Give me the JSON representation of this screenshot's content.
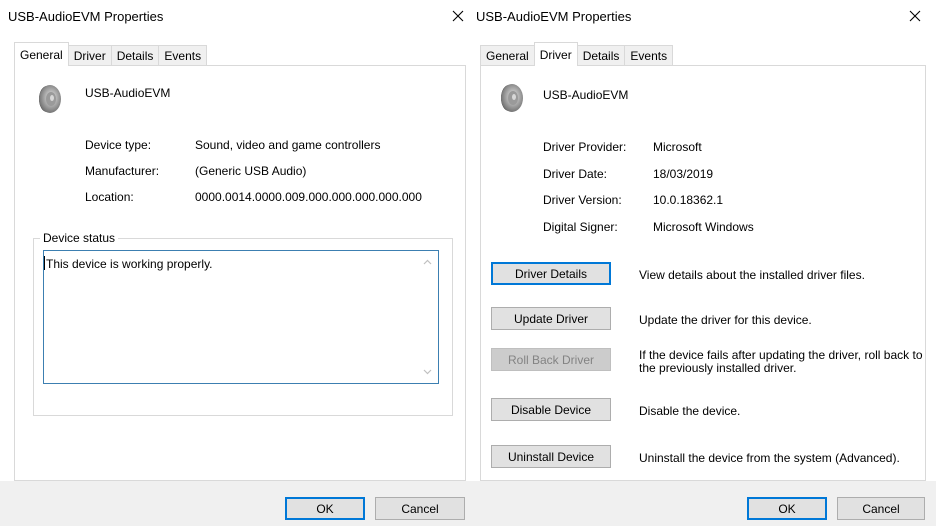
{
  "left": {
    "title": "USB-AudioEVM Properties",
    "tabs": [
      "General",
      "Driver",
      "Details",
      "Events"
    ],
    "device_name": "USB-AudioEVM",
    "fields": [
      {
        "label": "Device type:",
        "value": "Sound, video and game controllers"
      },
      {
        "label": "Manufacturer:",
        "value": "(Generic USB Audio)"
      },
      {
        "label": "Location:",
        "value": "0000.0014.0000.009.000.000.000.000.000"
      }
    ],
    "status_label": "Device status",
    "status_text": "This device is working properly.",
    "ok_label": "OK",
    "cancel_label": "Cancel"
  },
  "right": {
    "title": "USB-AudioEVM Properties",
    "tabs": [
      "General",
      "Driver",
      "Details",
      "Events"
    ],
    "device_name": "USB-AudioEVM",
    "fields": [
      {
        "label": "Driver Provider:",
        "value": "Microsoft"
      },
      {
        "label": "Driver Date:",
        "value": "18/03/2019"
      },
      {
        "label": "Driver Version:",
        "value": "10.0.18362.1"
      },
      {
        "label": "Digital Signer:",
        "value": "Microsoft Windows"
      }
    ],
    "actions": [
      {
        "label": "Driver Details",
        "desc": "View details about the installed driver files."
      },
      {
        "label": "Update Driver",
        "desc": "Update the driver for this device."
      },
      {
        "label": "Roll Back Driver",
        "desc": "If the device fails after updating the driver, roll back to the previously installed driver."
      },
      {
        "label": "Disable Device",
        "desc": "Disable the device."
      },
      {
        "label": "Uninstall Device",
        "desc": "Uninstall the device from the system (Advanced)."
      }
    ],
    "ok_label": "OK",
    "cancel_label": "Cancel"
  },
  "icons": {
    "device": "speaker-icon",
    "close": "close-icon"
  },
  "colors": {
    "accent": "#0078d7",
    "band": "#f0f0f0"
  }
}
